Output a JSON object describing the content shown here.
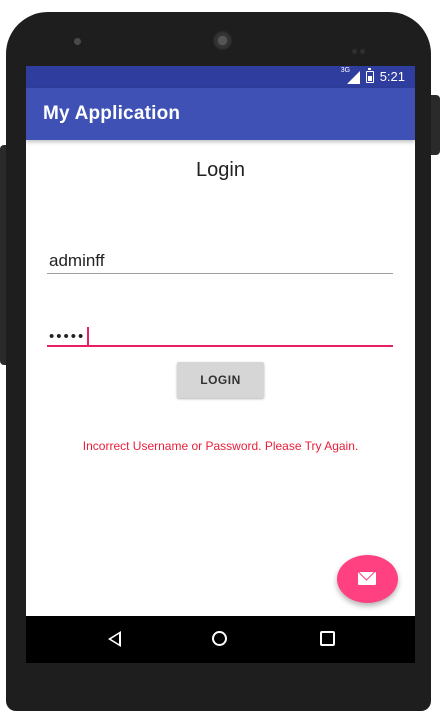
{
  "status_bar": {
    "network_label": "3G",
    "time": "5:21"
  },
  "app_bar": {
    "title": "My Application",
    "background_color": "#3f51b5"
  },
  "login_form": {
    "heading": "Login",
    "username_value": "adminff",
    "password_masked": "•••••",
    "login_button_label": "LOGIN",
    "error_message": "Incorrect Username or Password. Please Try Again.",
    "error_color": "#e91e3a",
    "accent_color": "#e91e63"
  },
  "fab": {
    "icon": "mail-icon",
    "color": "#ff4081"
  },
  "nav_bar": {
    "buttons": [
      "back-icon",
      "home-icon",
      "recent-apps-icon"
    ]
  }
}
